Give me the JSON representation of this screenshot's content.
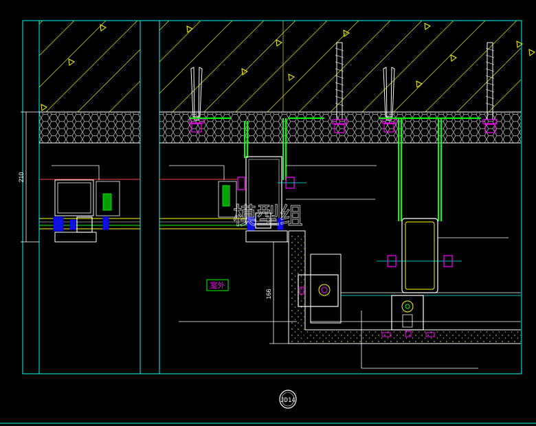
{
  "labels": {
    "dimension_left": "210",
    "dimension_mid": "166",
    "room_tag": "室外",
    "watermark": "模型组",
    "detail_bubble": "JD14"
  },
  "colors": {
    "background": "#000000",
    "frame": "#00ffff",
    "concrete_hatch": "#ffff00",
    "wall_line": "#00ff00",
    "anchor": "#ff00ff",
    "leader": "#ffffff",
    "section_blue": "#0000ff",
    "tag_text": "#ff00ff"
  },
  "icons": [
    "concrete-hatch-triangle",
    "expansion-anchor-bolt",
    "honeycomb-insulation"
  ]
}
